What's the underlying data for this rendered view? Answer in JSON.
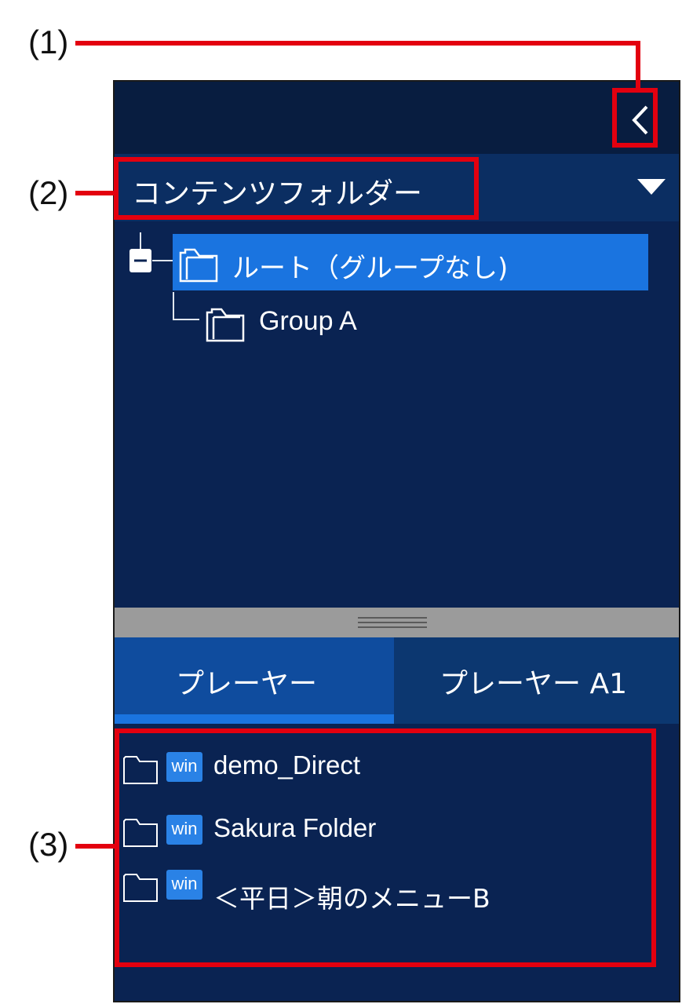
{
  "panel": {
    "folder_title": "コンテンツフォルダー",
    "tree": {
      "root_label": "ルート（グループなし)",
      "child_label": "Group A"
    },
    "tabs": [
      {
        "label": "プレーヤー",
        "active": true
      },
      {
        "label": "プレーヤー A1",
        "active": false
      }
    ],
    "items": [
      {
        "badge": "win",
        "label": "demo_Direct"
      },
      {
        "badge": "win",
        "label": "Sakura Folder"
      },
      {
        "badge": "win",
        "label": "＜平日＞朝のメニューB"
      }
    ]
  },
  "callouts": [
    {
      "label": "(1)"
    },
    {
      "label": "(2)"
    },
    {
      "label": "(3)"
    }
  ],
  "icons": [
    "chevron-left-icon",
    "dropdown-triangle-icon",
    "collapse-node-icon",
    "folder-icon"
  ],
  "colors": {
    "panel_bg": "#0a2352",
    "topbar_bg": "#081d40",
    "selected_row": "#1a74e0",
    "active_tab": "#0f4c9e",
    "tab_underline": "#1a74e0",
    "win_badge": "#2a82e6",
    "callout": "#e3000f"
  }
}
